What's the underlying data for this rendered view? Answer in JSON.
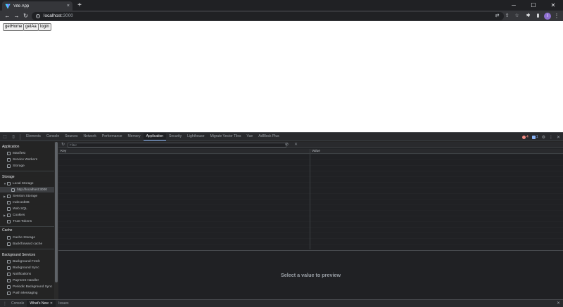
{
  "browser": {
    "tab_title": "Vite App",
    "tab_close": "×",
    "new_tab": "+",
    "window_minimize": "─",
    "window_maximize": "☐",
    "window_close": "✕",
    "url_host": "localhost",
    "url_port": ":3000",
    "profile_initial": "I"
  },
  "page": {
    "buttons": [
      "getHome",
      "getAa",
      "login"
    ]
  },
  "devtools": {
    "tabs": [
      "Elements",
      "Console",
      "Sources",
      "Network",
      "Performance",
      "Memory",
      "Application",
      "Security",
      "Lighthouse",
      "Migrate Vector Tiles",
      "Vue",
      "AdBlock Plus"
    ],
    "active_tab": "Application",
    "error_count": "4",
    "issue_count": "1",
    "sidebar": {
      "application_header": "Application",
      "application_items": [
        "Manifest",
        "Service Workers",
        "Storage"
      ],
      "storage_header": "Storage",
      "local_storage": "Local Storage",
      "local_storage_child": "http://localhost:3000",
      "storage_items": [
        "Session Storage",
        "IndexedDB",
        "Web SQL",
        "Cookies",
        "Trust Tokens"
      ],
      "cache_header": "Cache",
      "cache_items": [
        "Cache Storage",
        "Back/forward cache"
      ],
      "background_header": "Background Services",
      "background_items": [
        "Background Fetch",
        "Background Sync",
        "Notifications",
        "Payment Handler",
        "Periodic Background Sync",
        "Push Messaging"
      ]
    },
    "filter_placeholder": "Filter",
    "columns": {
      "key": "Key",
      "value": "Value"
    },
    "preview_text": "Select a value to preview",
    "drawer_tabs": [
      "Console",
      "What's New",
      "Issues"
    ],
    "drawer_active": "What's New"
  },
  "colors": {
    "accent": "#8ab4f8",
    "chrome_bg": "#202124",
    "devtools_bg": "#242424",
    "error": "#f28b82"
  }
}
